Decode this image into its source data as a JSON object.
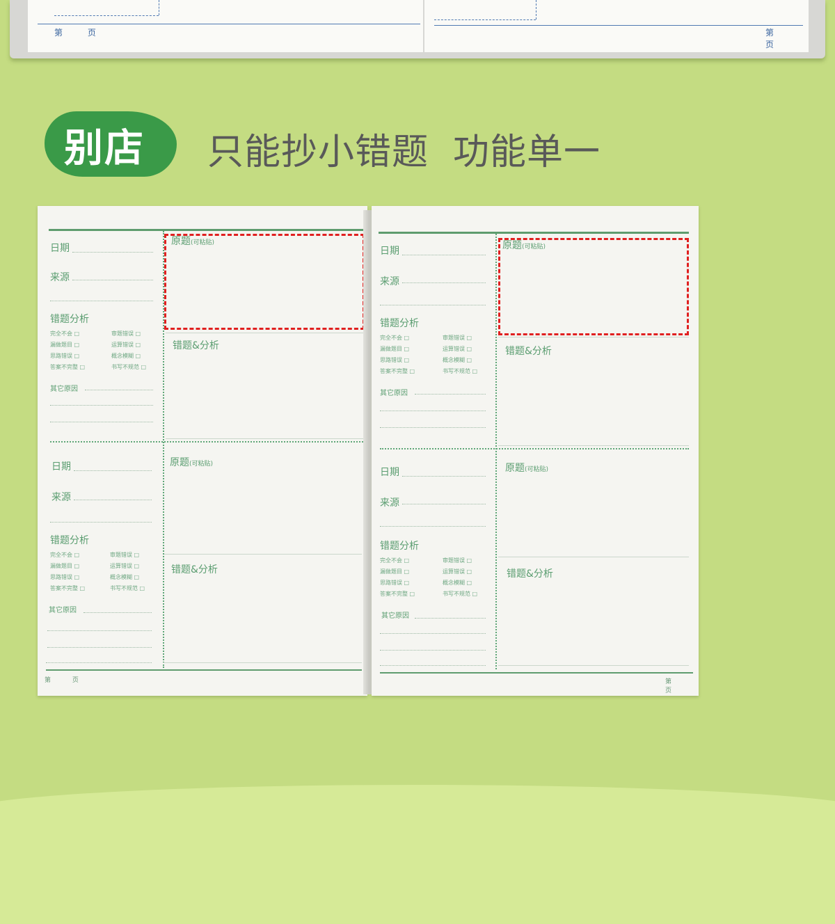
{
  "top_book": {
    "footer_left": "第 页",
    "footer_right": "第 页"
  },
  "badge": {
    "label": "别店"
  },
  "headline": "只能抄小错题  功能单一",
  "notebook": {
    "date_label": "日期",
    "source_label": "来源",
    "analysis_title": "错题分析",
    "original_label": "原题",
    "original_note": "(可粘贴)",
    "wrong_label": "错题&分析",
    "other_reason": "其它原因",
    "checks_left": [
      "完全不会 □",
      "漏做题目 □",
      "思路错误 □",
      "答案不完整 □"
    ],
    "checks_right": [
      "审题错误 □",
      "运算错误 □",
      "概念模糊 □",
      "书写不规范 □"
    ],
    "footer": "第 页"
  },
  "colors": {
    "background": "#c4dc82",
    "badge": "#3a9a48",
    "accent_green": "#5a9d70",
    "highlight_red": "#e02020"
  }
}
